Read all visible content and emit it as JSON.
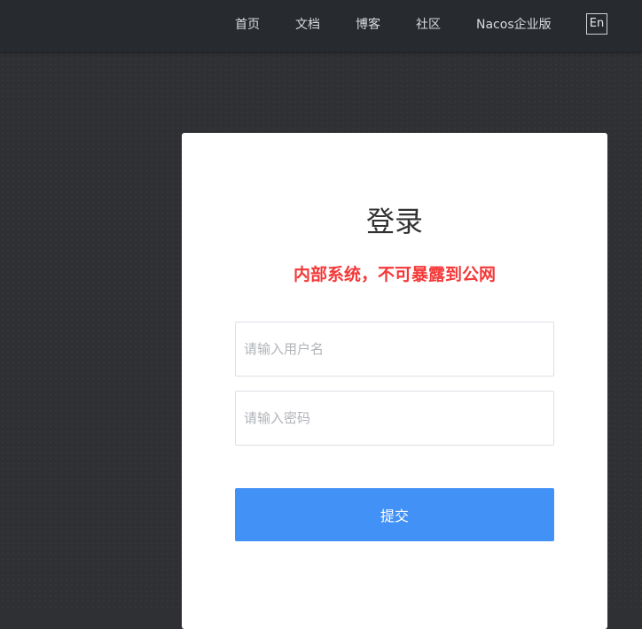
{
  "nav": {
    "items": [
      {
        "label": "首页"
      },
      {
        "label": "文档"
      },
      {
        "label": "博客"
      },
      {
        "label": "社区"
      },
      {
        "label": "Nacos企业版"
      }
    ],
    "lang_toggle": "En"
  },
  "login": {
    "title": "登录",
    "warning": "内部系统，不可暴露到公网",
    "username_placeholder": "请输入用户名",
    "password_placeholder": "请输入密码",
    "submit_label": "提交"
  },
  "colors": {
    "background": "#2e3034",
    "topbar": "#272a2e",
    "warning": "#f43838",
    "primary_button": "#4291f7"
  }
}
